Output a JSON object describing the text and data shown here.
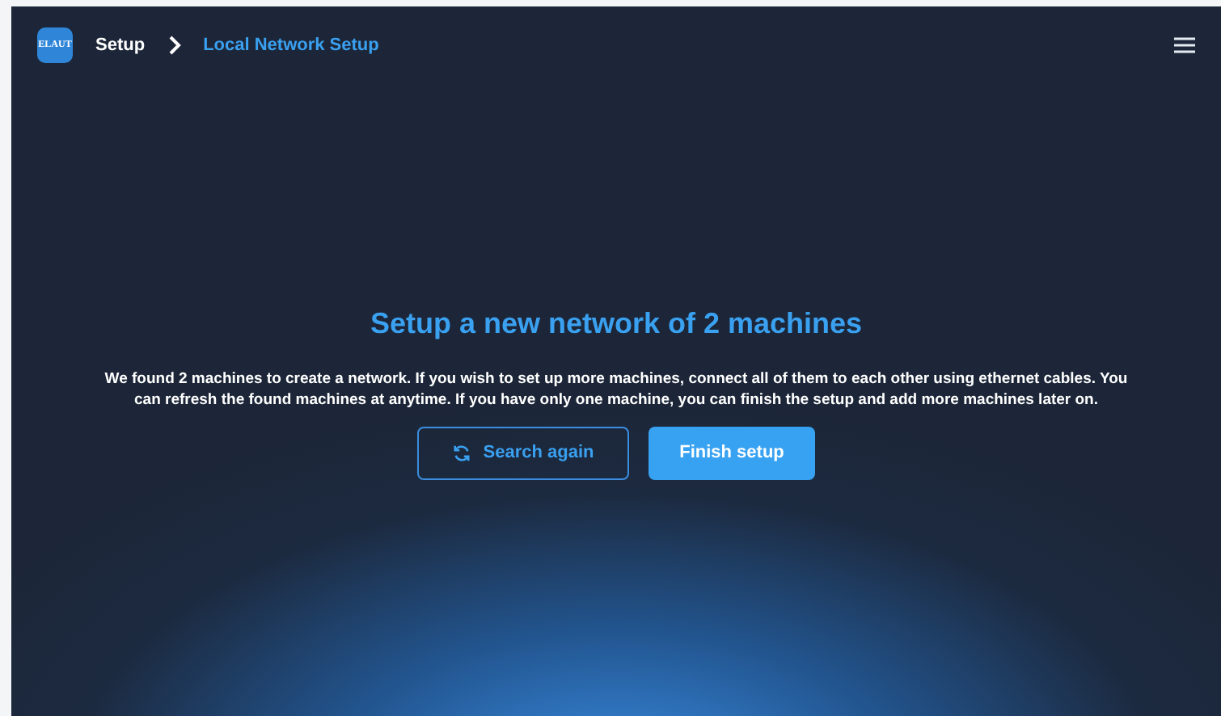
{
  "header": {
    "logo": "ELAUT",
    "breadcrumb": [
      {
        "label": "Setup",
        "selected": false
      },
      {
        "label": "Local Network Setup",
        "selected": true
      }
    ]
  },
  "title": "Setup a new network of 2 machines",
  "description": "We found 2 machines to create a network. If you wish to set up more machines, connect all of them to each other using ethernet cables. You can refresh the found machines at anytime. If you have only one machine, you can finish the setup and add more machines later on.",
  "buttons": [
    {
      "label": "Search again",
      "kind": "outline"
    },
    {
      "label": "Finish setup",
      "kind": "primary"
    }
  ]
}
